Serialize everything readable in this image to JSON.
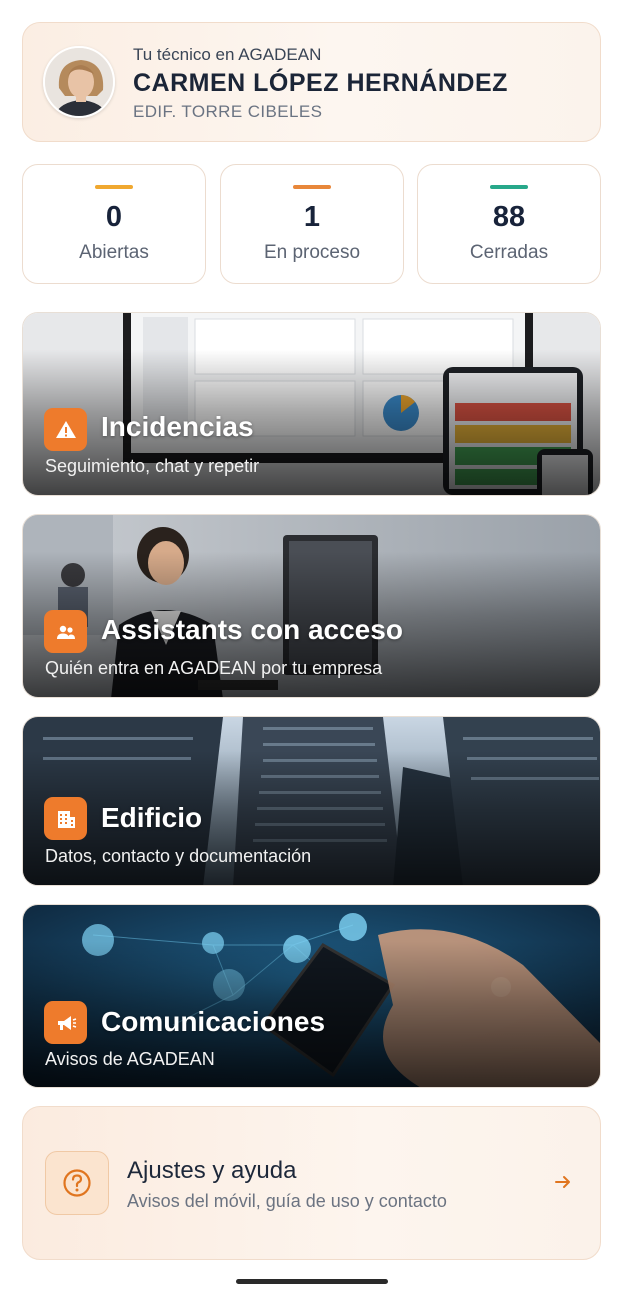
{
  "technician": {
    "subtitle": "Tu técnico en AGADEAN",
    "name": "CARMEN LÓPEZ HERNÁNDEZ",
    "building": "EDIF. TORRE CIBELES"
  },
  "stats": [
    {
      "value": "0",
      "label": "Abiertas",
      "color": "#f0a830"
    },
    {
      "value": "1",
      "label": "En proceso",
      "color": "#e8873a"
    },
    {
      "value": "88",
      "label": "Cerradas",
      "color": "#27a88a"
    }
  ],
  "tiles": [
    {
      "title": "Incidencias",
      "description": "Seguimiento, chat y repetir",
      "icon": "warning-icon"
    },
    {
      "title": "Assistants con acceso",
      "description": "Quién entra en AGADEAN por tu empresa",
      "icon": "users-icon"
    },
    {
      "title": "Edificio",
      "description": "Datos, contacto y documentación",
      "icon": "building-icon"
    },
    {
      "title": "Comunicaciones",
      "description": "Avisos de AGADEAN",
      "icon": "megaphone-icon"
    }
  ],
  "settings": {
    "title": "Ajustes y ayuda",
    "description": "Avisos del móvil, guía de uso y contacto",
    "icon": "help-circle-icon"
  },
  "accent_color": "#ee7b2c"
}
